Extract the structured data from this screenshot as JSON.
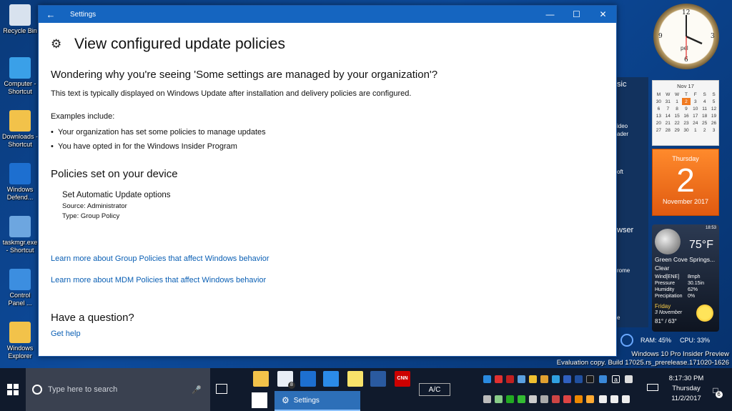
{
  "desktop": {
    "icons": [
      {
        "label": "Recycle Bin",
        "icon": "recycle-bin-icon",
        "color": "#d8e2ee"
      },
      {
        "label": "Computer - Shortcut",
        "icon": "computer-icon",
        "color": "#3aa0e8"
      },
      {
        "label": "Downloads - Shortcut",
        "icon": "downloads-folder-icon",
        "color": "#f2c24a"
      },
      {
        "label": "Windows Defend...",
        "icon": "windows-defender-icon",
        "color": "#1d6fd0"
      },
      {
        "label": "taskmgr.exe - Shortcut",
        "icon": "task-manager-icon",
        "color": "#6da6e0"
      },
      {
        "label": "Control Panel ...",
        "icon": "control-panel-icon",
        "color": "#3c8ee0"
      },
      {
        "label": "Windows Explorer",
        "icon": "explorer-folder-icon",
        "color": "#f2c24a"
      }
    ]
  },
  "window": {
    "title": "Settings",
    "page_title": "View configured update policies",
    "question_heading": "Wondering why you're seeing 'Some settings are managed by your organization'?",
    "description": "This text is typically displayed on Windows Update after installation and delivery policies are configured.",
    "examples_label": "Examples include:",
    "examples": [
      "Your organization has set some policies to manage updates",
      "You have opted in for the Windows Insider Program"
    ],
    "policies_heading": "Policies set on your device",
    "policy": {
      "name": "Set Automatic Update options",
      "source": "Source: Administrator",
      "type": "Type: Group Policy"
    },
    "link_group_policies": "Learn more about Group Policies that affect Windows behavior",
    "link_mdm_policies": "Learn more about MDM Policies that affect Windows behavior",
    "help_heading": "Have a question?",
    "help_link": "Get help"
  },
  "background_panel": {
    "labels": [
      "sic",
      "ideo",
      "ader",
      "oft",
      "wser",
      "rome",
      "e"
    ]
  },
  "gadgets": {
    "clock": {
      "numbers": [
        "12",
        "3",
        "6",
        "9"
      ],
      "brand": "pel"
    },
    "calendar": {
      "month": "Nov 17",
      "weekdays": [
        "M",
        "W",
        "W",
        "T",
        "F",
        "S",
        "S"
      ],
      "weeks": [
        [
          "30",
          "31",
          "1",
          "2",
          "3",
          "4",
          "5"
        ],
        [
          "6",
          "7",
          "8",
          "9",
          "10",
          "11",
          "12"
        ],
        [
          "13",
          "14",
          "15",
          "16",
          "17",
          "18",
          "19"
        ],
        [
          "20",
          "21",
          "22",
          "23",
          "24",
          "25",
          "26"
        ],
        [
          "27",
          "28",
          "29",
          "30",
          "1",
          "2",
          "3"
        ]
      ],
      "today": "2"
    },
    "bigdate": {
      "weekday": "Thursday",
      "day": "2",
      "month_year": "November 2017"
    },
    "weather": {
      "time": "18:53",
      "temp": "75°F",
      "location": "Green Cove Springs...",
      "condition": "Clear",
      "rows": [
        {
          "k": "Wind[ENE]",
          "v": "8mph"
        },
        {
          "k": "Pressure",
          "v": "30.15in"
        },
        {
          "k": "Humidity",
          "v": "62%"
        },
        {
          "k": "Precipitation",
          "v": "0%"
        }
      ],
      "forecast_day": "Friday",
      "forecast_date": "3 November",
      "forecast_range": "81° / 63°"
    },
    "sysmon": {
      "ram": "RAM: 45%",
      "cpu": "CPU: 33%"
    }
  },
  "watermark": {
    "line1": "Windows 10 Pro Insider Preview",
    "line2": "Evaluation copy. Build 17025.rs_prerelease.171020-1626"
  },
  "taskbar": {
    "search_placeholder": "Type here to search",
    "active_app": "Settings",
    "ac_label": "A/C",
    "time": "8:17:30 PM",
    "day": "Thursday",
    "date": "11/2/2017",
    "notification_count": "6",
    "mail_badge": "8",
    "cnn_label": "CNN",
    "ime_label": "a",
    "pinned": [
      {
        "name": "file-explorer-pinned",
        "color": "#f2c24a"
      },
      {
        "name": "mail-pinned",
        "color": "#e8eef6"
      },
      {
        "name": "store-pinned",
        "color": "#1d6fd0"
      },
      {
        "name": "edge-pinned",
        "color": "#2b8be8"
      },
      {
        "name": "sticky-notes-pinned",
        "color": "#f7e26a"
      },
      {
        "name": "powershell-pinned",
        "color": "#2a5aa0"
      },
      {
        "name": "cnn-pinned",
        "color": "#cc0000"
      }
    ]
  }
}
